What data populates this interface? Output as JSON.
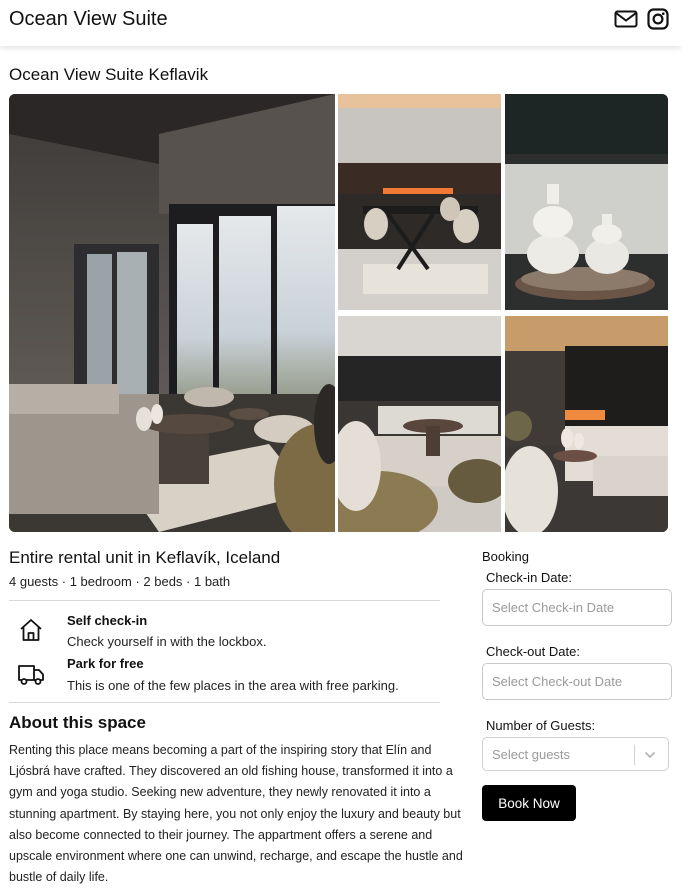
{
  "header": {
    "brand": "Ocean View Suite",
    "icons": [
      "mail-icon",
      "instagram-icon"
    ]
  },
  "listing": {
    "title": "Ocean View Suite Keflavik"
  },
  "gallery": {
    "photos": [
      "living-room-main-photo",
      "dining-table-photo",
      "white-vases-photo",
      "living-room-side-photo",
      "lounge-area-photo"
    ]
  },
  "unit": {
    "title": "Entire rental unit in Keflavík, Iceland",
    "meta": "4 guests · 1 bedroom · 2 beds · 1 bath"
  },
  "features": [
    {
      "icon": "home-icon",
      "title": "Self check-in",
      "desc": "Check yourself in with the lockbox."
    },
    {
      "icon": "truck-icon",
      "title": "Park for free",
      "desc": "This is one of the few places in the area with free parking."
    }
  ],
  "about": {
    "heading": "About this space",
    "text": "Renting this place means becoming a part of the inspiring story that Elín and Ljósbrá have crafted. They discovered an old fishing house, transformed it into a gym and yoga studio. Seeking new adventure, they newly renovated it into a stunning apartment. By staying here, you not only enjoy the luxury and beauty but also become connected to their journey. The appartment offers a serene and upscale environment where one can unwind, recharge, and escape the hustle and bustle of daily life."
  },
  "booking": {
    "label": "Booking",
    "checkin_label": "Check-in Date:",
    "checkin_placeholder": "Select Check-in Date",
    "checkout_label": "Check-out Date:",
    "checkout_placeholder": "Select Check-out Date",
    "guests_label": "Number of Guests:",
    "guests_placeholder": "Select guests",
    "book_button": "Book Now"
  }
}
